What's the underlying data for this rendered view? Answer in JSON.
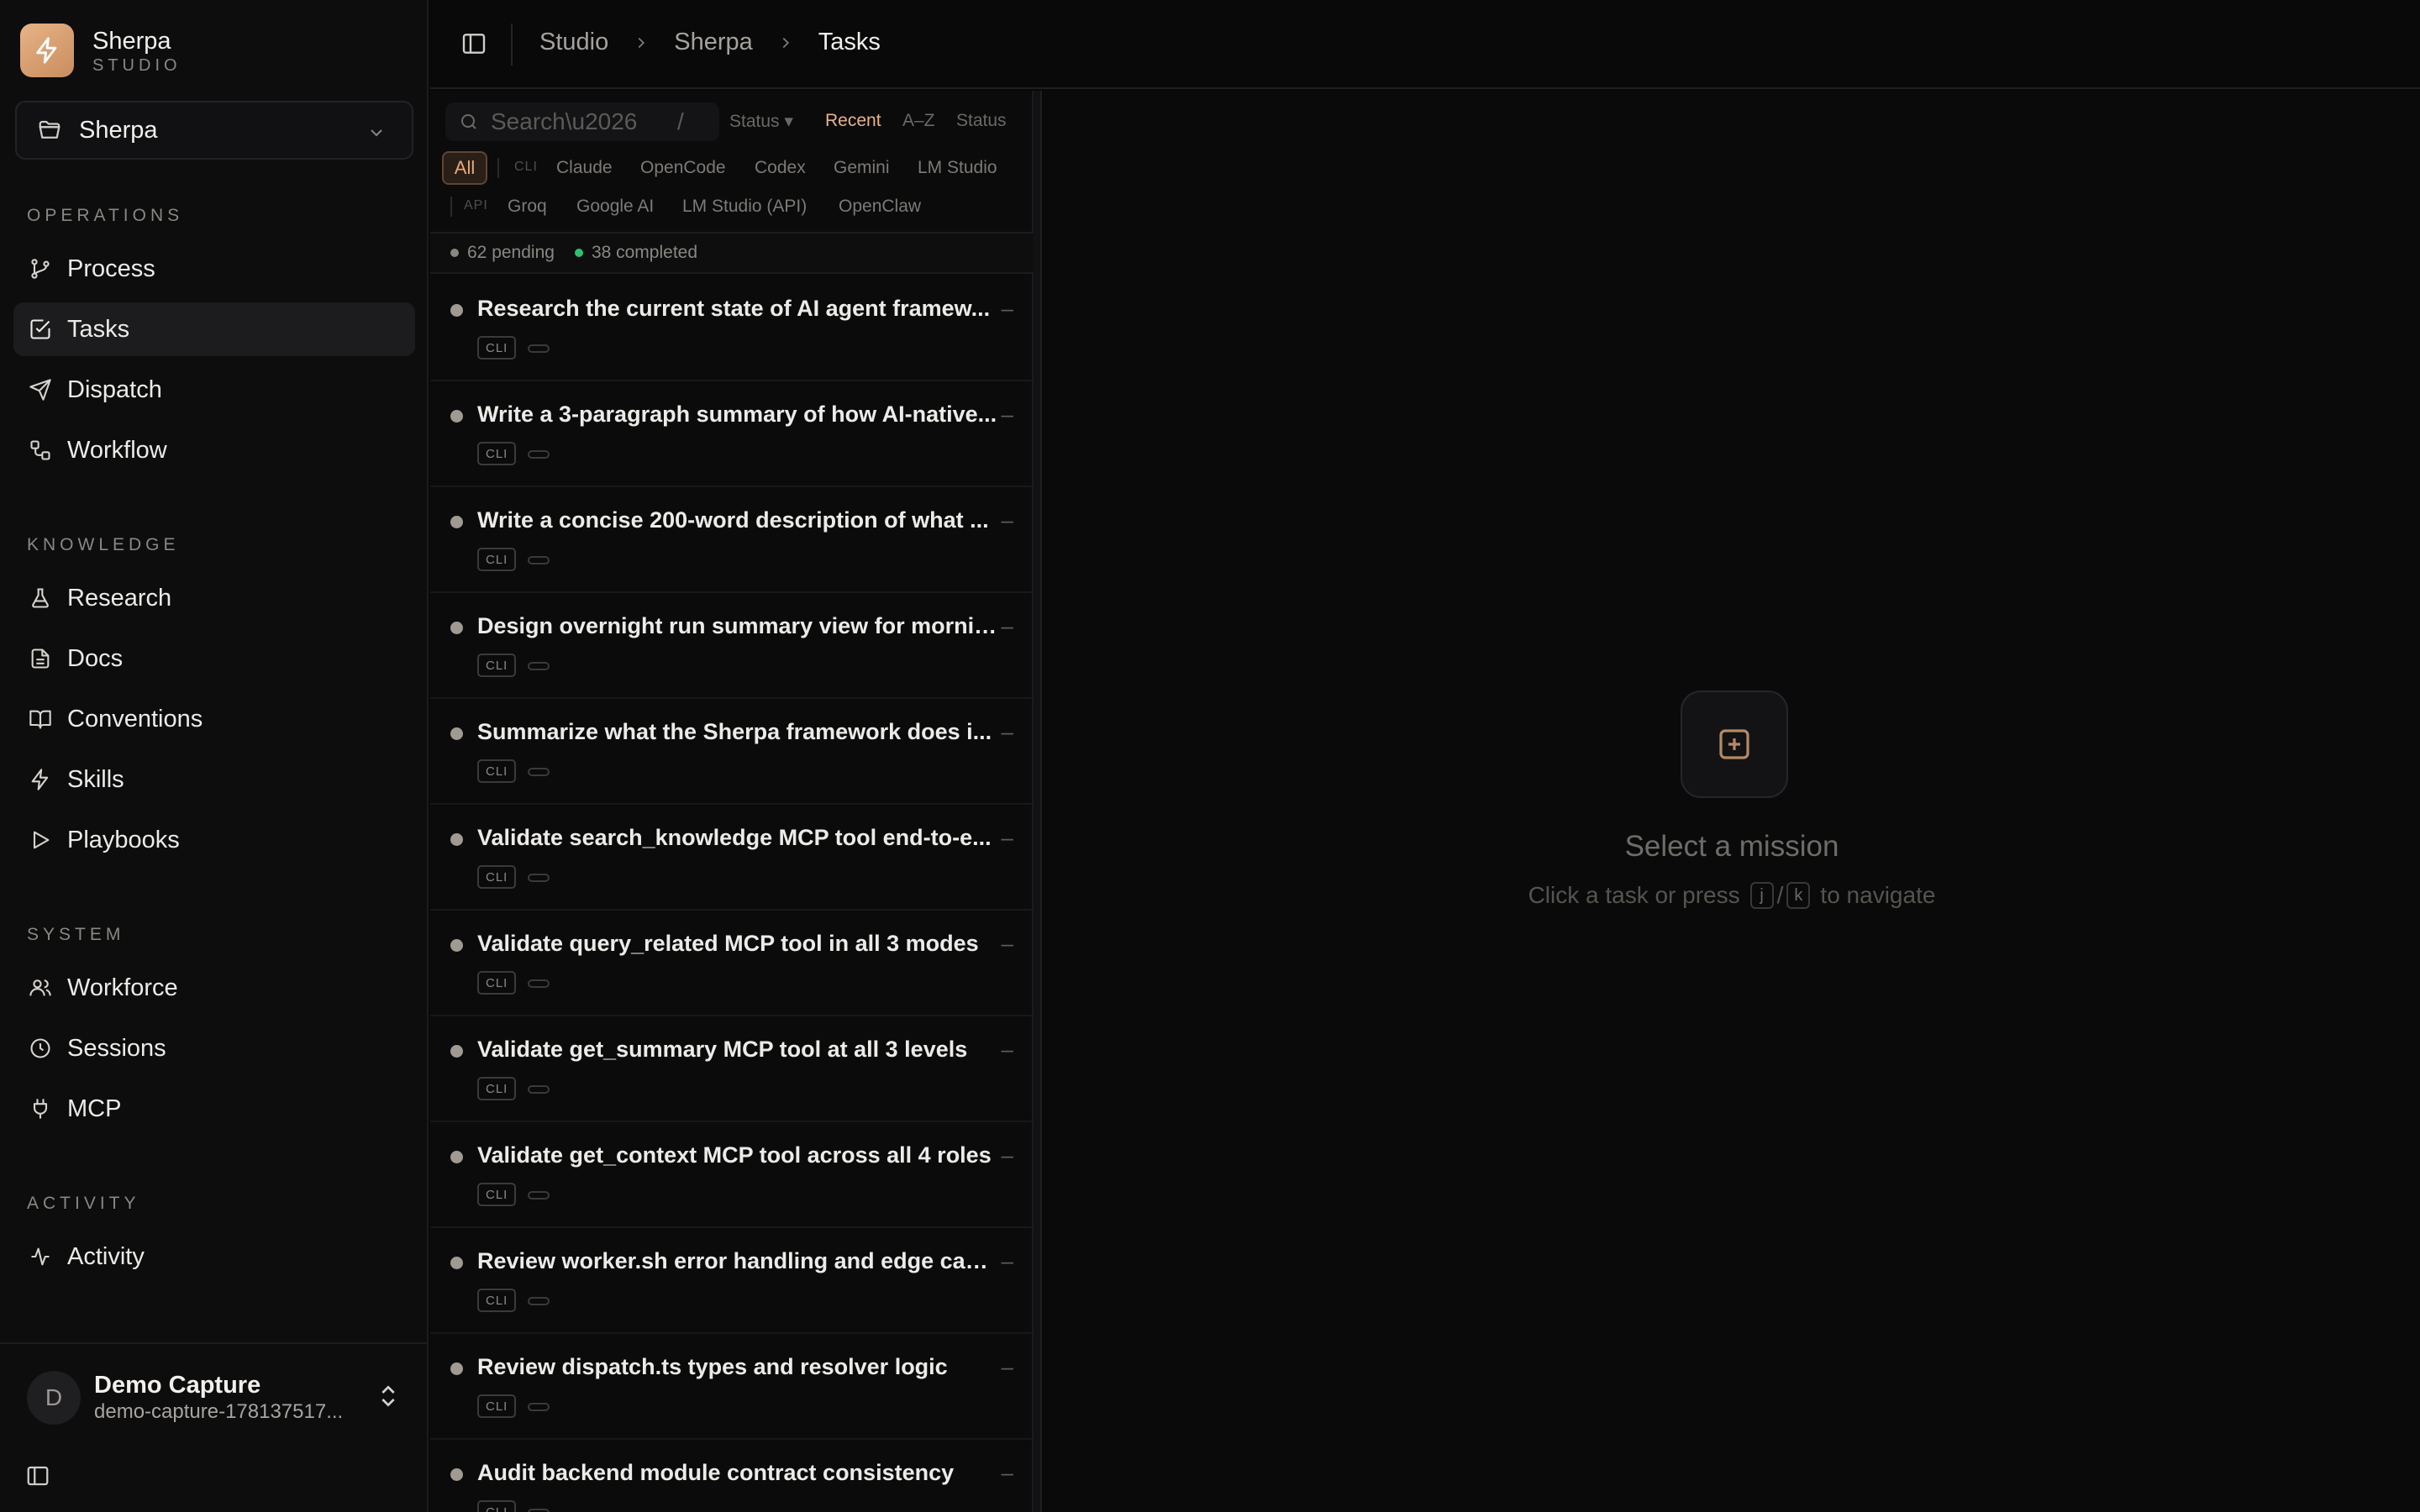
{
  "brand": {
    "name": "Sherpa",
    "subtitle": "STUDIO"
  },
  "project": {
    "selected": "Sherpa"
  },
  "sidebar": {
    "sections": [
      {
        "label": "OPERATIONS",
        "items": [
          {
            "label": "Process",
            "icon": "git-branch-icon"
          },
          {
            "label": "Tasks",
            "icon": "check-square-icon",
            "active": true
          },
          {
            "label": "Dispatch",
            "icon": "send-icon"
          },
          {
            "label": "Workflow",
            "icon": "workflow-icon"
          }
        ]
      },
      {
        "label": "KNOWLEDGE",
        "items": [
          {
            "label": "Research",
            "icon": "flask-icon"
          },
          {
            "label": "Docs",
            "icon": "file-text-icon"
          },
          {
            "label": "Conventions",
            "icon": "book-open-icon"
          },
          {
            "label": "Skills",
            "icon": "zap-icon"
          },
          {
            "label": "Playbooks",
            "icon": "play-icon"
          }
        ]
      },
      {
        "label": "SYSTEM",
        "items": [
          {
            "label": "Workforce",
            "icon": "users-icon"
          },
          {
            "label": "Sessions",
            "icon": "clock-icon"
          },
          {
            "label": "MCP",
            "icon": "plug-icon"
          }
        ]
      },
      {
        "label": "ACTIVITY",
        "items": [
          {
            "label": "Activity",
            "icon": "activity-icon"
          }
        ]
      }
    ]
  },
  "account": {
    "initial": "D",
    "name": "Demo Capture",
    "email": "demo-capture-178137517..."
  },
  "breadcrumb": [
    "Studio",
    "Sherpa",
    "Tasks"
  ],
  "search": {
    "placeholder": "Search\\u2026",
    "shortcut": "/"
  },
  "sort": {
    "status_dropdown": "Status ▾",
    "options": [
      "Recent",
      "A–Z",
      "Status"
    ],
    "active": "Recent"
  },
  "filters": {
    "all": "All",
    "cli_group": "CLI",
    "cli": [
      "Claude",
      "OpenCode",
      "Codex",
      "Gemini",
      "LM Studio"
    ],
    "api_group": "API",
    "api": [
      "Groq",
      "Google AI",
      "LM Studio (API)",
      "OpenClaw"
    ]
  },
  "counts": {
    "pending": "62 pending",
    "completed": "38 completed",
    "pending_color": "#8a8782",
    "completed_color": "#2fbf71"
  },
  "tasks": [
    {
      "title": "Research the current state of AI agent framew...",
      "badge": "CLI",
      "meta": "–"
    },
    {
      "title": "Write a 3-paragraph summary of how AI-native...",
      "badge": "CLI",
      "meta": "–"
    },
    {
      "title": "Write a concise 200-word description of what ...",
      "badge": "CLI",
      "meta": "–"
    },
    {
      "title": "Design overnight run summary view for mornin...",
      "badge": "CLI",
      "meta": "–"
    },
    {
      "title": "Summarize what the Sherpa framework does i...",
      "badge": "CLI",
      "meta": "–"
    },
    {
      "title": "Validate search_knowledge MCP tool end-to-e...",
      "badge": "CLI",
      "meta": "–"
    },
    {
      "title": "Validate query_related MCP tool in all 3 modes",
      "badge": "CLI",
      "meta": "–"
    },
    {
      "title": "Validate get_summary MCP tool at all 3 levels",
      "badge": "CLI",
      "meta": "–"
    },
    {
      "title": "Validate get_context MCP tool across all 4 roles",
      "badge": "CLI",
      "meta": "–"
    },
    {
      "title": "Review worker.sh error handling and edge cases",
      "badge": "CLI",
      "meta": "–"
    },
    {
      "title": "Review dispatch.ts types and resolver logic",
      "badge": "CLI",
      "meta": "–"
    },
    {
      "title": "Audit backend module contract consistency",
      "badge": "CLI",
      "meta": "–"
    }
  ],
  "empty_state": {
    "title": "Select a mission",
    "sub_before": "Click a task or press",
    "key1": "j",
    "key_sep": "/",
    "key2": "k",
    "sub_after": "to navigate"
  },
  "colors": {
    "accent": "#e8a877",
    "background": "#09090a",
    "sidebar": "#0d0d0e"
  }
}
